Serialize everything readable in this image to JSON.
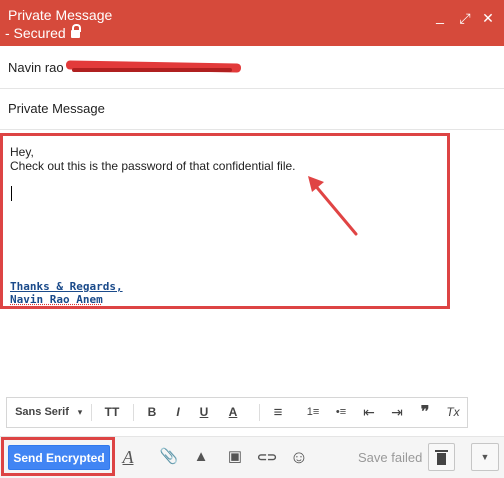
{
  "window": {
    "title": "Private Message",
    "subtitle": "- Secured",
    "controls": {
      "minimize": "_",
      "popout": "⤢",
      "close": "✕"
    }
  },
  "compose": {
    "recipient_name": "Navin rao",
    "subject": "Private Message",
    "body": {
      "greeting": "Hey,",
      "message": "Check out this is the password of that confidential file.",
      "signature_line1": "Thanks & Regards,",
      "signature_line2": "Navin Rao Anem"
    }
  },
  "format_toolbar": {
    "font": "Sans Serif",
    "font_dropdown_icon": "▾",
    "size_icon": "TT",
    "bold": "B",
    "italic": "I",
    "underline": "U",
    "text_color": "A",
    "align": "≡",
    "numbered_list": "1≡",
    "bulleted_list": "•≡",
    "indent_less": "⇤",
    "indent_more": "⇥",
    "quote": "❞",
    "clear_format": "Tx"
  },
  "bottom_bar": {
    "send_label": "Send Encrypted",
    "save_status": "Save failed",
    "format_icon": "A",
    "attach_icon": "📎",
    "drive_icon": "▲",
    "photo_icon": "▣",
    "link_icon": "⊂⊃",
    "emoji_icon": "☺",
    "more_icon": "▼"
  },
  "colors": {
    "header": "#d64a3b",
    "highlight_border": "#dd4444",
    "send_button": "#4185f4",
    "signature": "#1a4a8a"
  }
}
